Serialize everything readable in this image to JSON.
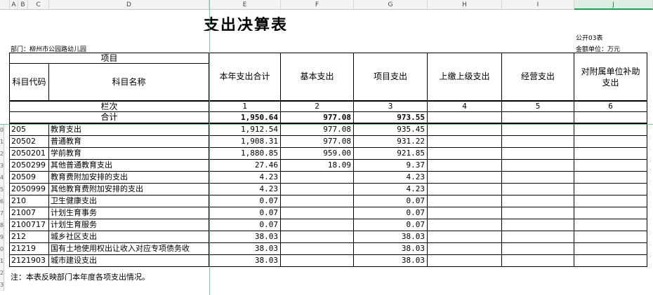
{
  "columns": [
    "A",
    "B",
    "C",
    "D",
    "E",
    "F",
    "G",
    "H",
    "I",
    "J"
  ],
  "selected_column": "J",
  "row_numbers": [
    "0",
    "1",
    "2",
    "3",
    "4",
    "5",
    "6",
    "7",
    "8",
    "9",
    "0",
    "1",
    "2",
    "3"
  ],
  "title": "支出决算表",
  "form_no": "公开03表",
  "department": "部门：柳州市公园路幼儿园",
  "unit": "金额单位：万元",
  "header": {
    "item": "项目",
    "code": "科目代码",
    "name": "科目名称",
    "total": "本年支出合计",
    "basic": "基本支出",
    "project": "项目支出",
    "upper": "上缴上级支出",
    "business": "经营支出",
    "subsidy": "对附属单位补助支出",
    "line_label": "栏次",
    "total_label": "合计",
    "col_nums": [
      "1",
      "2",
      "3",
      "4",
      "5",
      "6"
    ]
  },
  "totals": {
    "total": "1,950.64",
    "basic": "977.08",
    "project": "973.55"
  },
  "rows": [
    {
      "code": "205",
      "name": "教育支出",
      "total": "1,912.54",
      "basic": "977.08",
      "project": "935.45"
    },
    {
      "code": "20502",
      "name": "普通教育",
      "total": "1,908.31",
      "basic": "977.08",
      "project": "931.22"
    },
    {
      "code": "2050201",
      "name": "学前教育",
      "total": "1,880.85",
      "basic": "959.00",
      "project": "921.85"
    },
    {
      "code": "2050299",
      "name": "其他普通教育支出",
      "total": "27.46",
      "basic": "18.09",
      "project": "9.37"
    },
    {
      "code": "20509",
      "name": "教育费附加安排的支出",
      "total": "4.23",
      "basic": "",
      "project": "4.23"
    },
    {
      "code": "2050999",
      "name": "其他教育费附加安排的支出",
      "total": "4.23",
      "basic": "",
      "project": "4.23"
    },
    {
      "code": "210",
      "name": "卫生健康支出",
      "total": "0.07",
      "basic": "",
      "project": "0.07"
    },
    {
      "code": "21007",
      "name": "计划生育事务",
      "total": "0.07",
      "basic": "",
      "project": "0.07"
    },
    {
      "code": "2100717",
      "name": "计划生育服务",
      "total": "0.07",
      "basic": "",
      "project": "0.07"
    },
    {
      "code": "212",
      "name": "城乡社区支出",
      "total": "38.03",
      "basic": "",
      "project": "38.03"
    },
    {
      "code": "21219",
      "name": "国有土地使用权出让收入对应专项债务收",
      "total": "38.03",
      "basic": "",
      "project": "38.03"
    },
    {
      "code": "2121903",
      "name": "城市建设支出",
      "total": "38.03",
      "basic": "",
      "project": "38.03"
    }
  ],
  "note": "注：本表反映部门本年度各项支出情况。"
}
